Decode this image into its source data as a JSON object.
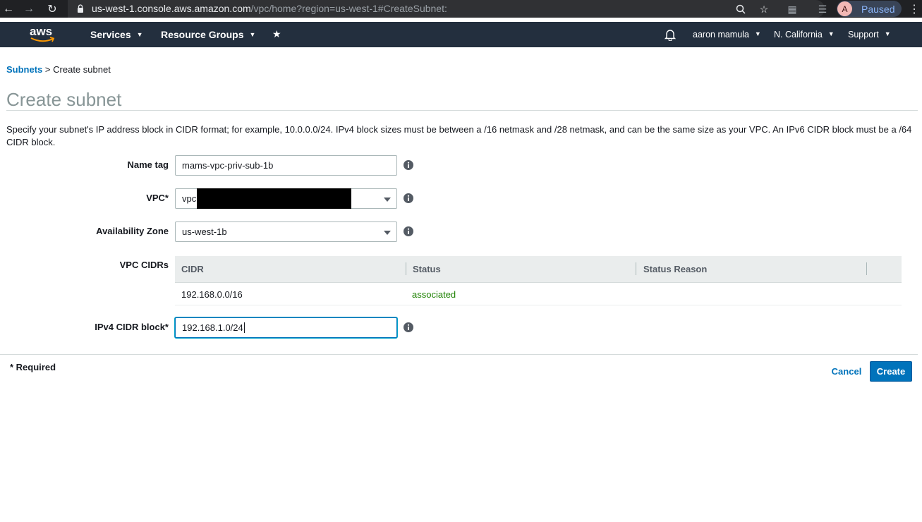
{
  "browser": {
    "url_host": "us-west-1.console.aws.amazon.com",
    "url_rest": "/vpc/home?region=us-west-1#CreateSubnet:",
    "profile_initial": "A",
    "profile_status": "Paused"
  },
  "awsnav": {
    "logo": "aws",
    "services": "Services",
    "resource_groups": "Resource Groups",
    "user": "aaron mamula",
    "region": "N. California",
    "support": "Support"
  },
  "breadcrumb": {
    "parent": "Subnets",
    "separator": ">",
    "current": "Create subnet"
  },
  "page": {
    "title": "Create subnet",
    "description": "Specify your subnet's IP address block in CIDR format; for example, 10.0.0.0/24. IPv4 block sizes must be between a /16 netmask and /28 netmask, and can be the same size as your VPC. An IPv6 CIDR block must be a /64 CIDR block."
  },
  "form": {
    "name_tag_label": "Name tag",
    "name_tag_value": "mams-vpc-priv-sub-1b",
    "vpc_label": "VPC*",
    "vpc_value": "vpc",
    "az_label": "Availability Zone",
    "az_value": "us-west-1b",
    "vpc_cidrs_label": "VPC CIDRs",
    "ipv4_label": "IPv4 CIDR block*",
    "ipv4_value": "192.168.1.0/24"
  },
  "cidr_table": {
    "headers": [
      "CIDR",
      "Status",
      "Status Reason"
    ],
    "rows": [
      {
        "cidr": "192.168.0.0/16",
        "status": "associated",
        "reason": ""
      }
    ]
  },
  "footer": {
    "required_note": "* Required",
    "cancel_label": "Cancel",
    "create_label": "Create"
  }
}
